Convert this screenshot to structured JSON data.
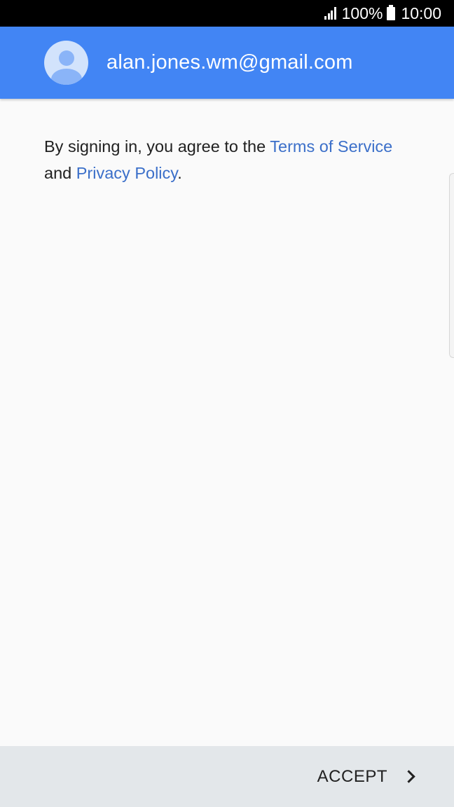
{
  "status_bar": {
    "battery": "100%",
    "time": "10:00"
  },
  "header": {
    "email": "alan.jones.wm@gmail.com",
    "color": "#4285f4"
  },
  "content": {
    "text_before": "By signing in, you agree to the ",
    "terms_link": "Terms of Service",
    "text_middle": " and ",
    "privacy_link": "Privacy Policy",
    "text_after": ".",
    "link_color": "#3b6fc9"
  },
  "footer": {
    "accept_label": "ACCEPT"
  },
  "icons": {
    "signal": "signal-icon",
    "battery": "battery-icon",
    "avatar": "account-avatar-icon",
    "chevron": "chevron-right-icon"
  }
}
